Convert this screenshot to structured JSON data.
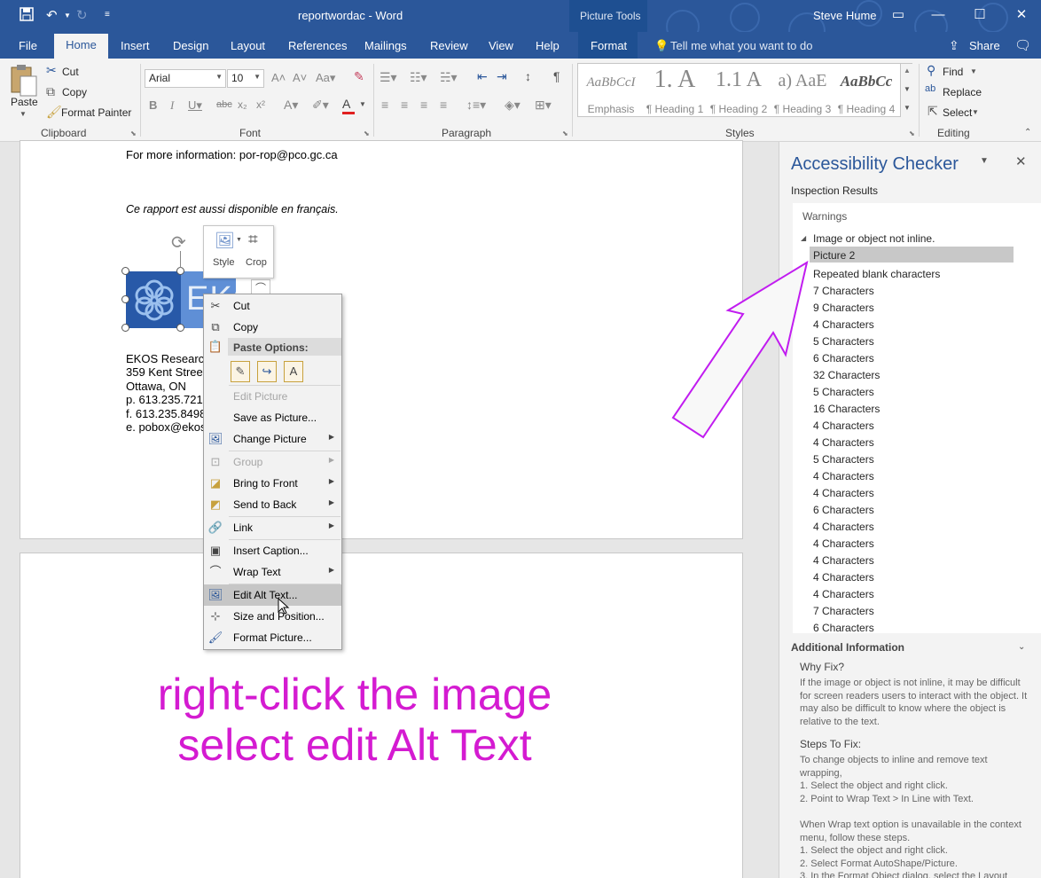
{
  "titlebar": {
    "doc_title": "reportwordac  -  Word",
    "context_title": "Picture Tools",
    "user": "Steve Hume"
  },
  "tabs": {
    "file": "File",
    "home": "Home",
    "insert": "Insert",
    "design": "Design",
    "layout": "Layout",
    "references": "References",
    "mailings": "Mailings",
    "review": "Review",
    "view": "View",
    "help": "Help",
    "format": "Format",
    "tell_me": "Tell me what you want to do",
    "share": "Share"
  },
  "ribbon": {
    "clipboard": {
      "paste": "Paste",
      "cut": "Cut",
      "copy": "Copy",
      "format_painter": "Format Painter",
      "label": "Clipboard"
    },
    "font": {
      "family": "Arial",
      "size": "10",
      "label": "Font"
    },
    "paragraph": {
      "label": "Paragraph"
    },
    "styles": {
      "label": "Styles",
      "items": [
        {
          "preview": "AaBbCcI",
          "name": "Emphasis"
        },
        {
          "preview": "1.  A",
          "name": "¶ Heading 1"
        },
        {
          "preview": "1.1  A",
          "name": "¶ Heading 2"
        },
        {
          "preview": "a)  AaE",
          "name": "¶ Heading 3"
        },
        {
          "preview": "AaBbCc",
          "name": "¶ Heading 4"
        }
      ]
    },
    "editing": {
      "find": "Find",
      "replace": "Replace",
      "select": "Select",
      "label": "Editing"
    }
  },
  "document": {
    "more_info": "For more information: por-rop@pco.gc.ca",
    "french_note": "Ce rapport est aussi disponible en français.",
    "address_lines": [
      "EKOS Research",
      "359 Kent Street",
      "Ottawa, ON",
      "p. 613.235.7215",
      "f. 613.235.8498",
      "e. pobox@ekos"
    ],
    "logo_text": "EKOS",
    "mini_toolbar": {
      "style": "Style",
      "crop": "Crop"
    }
  },
  "context_menu": {
    "cut": "Cut",
    "copy": "Copy",
    "paste_options": "Paste Options:",
    "edit_picture": "Edit Picture",
    "save_as_picture": "Save as Picture...",
    "change_picture": "Change Picture",
    "group": "Group",
    "bring_to_front": "Bring to Front",
    "send_to_back": "Send to Back",
    "link": "Link",
    "insert_caption": "Insert Caption...",
    "wrap_text": "Wrap Text",
    "edit_alt_text": "Edit Alt Text...",
    "size_and_position": "Size and Position...",
    "format_picture": "Format Picture..."
  },
  "annotation": {
    "line1": "right-click the image",
    "line2": "select edit Alt Text",
    "color": "#d41bd1"
  },
  "accessibility_pane": {
    "title": "Accessibility Checker",
    "inspection_results": "Inspection Results",
    "warnings": "Warnings",
    "group_header": "Image or object not inline.",
    "selected_item": "Picture 2",
    "items": [
      "Repeated blank characters",
      "7 Characters",
      "9 Characters",
      "4 Characters",
      "5 Characters",
      "6 Characters",
      "32 Characters",
      "5 Characters",
      "16 Characters",
      "4 Characters",
      "4 Characters",
      "5 Characters",
      "4 Characters",
      "4 Characters",
      "6 Characters",
      "4 Characters",
      "4 Characters",
      "4 Characters",
      "4 Characters",
      "4 Characters",
      "7 Characters",
      "6 Characters"
    ],
    "additional_information": "Additional Information",
    "why_fix_heading": "Why Fix?",
    "why_fix_text": "If the image or object is not inline, it may be difficult for screen readers users to interact with the object. It may also be difficult to know where the object is relative to the text.",
    "steps_heading": "Steps To Fix:",
    "steps_text_1": "To change objects to inline and remove text wrapping,",
    "steps_text_2": "1. Select the object and right click.",
    "steps_text_3": "2. Point to Wrap Text > In Line with Text.",
    "steps_text_4": "When Wrap text option is unavailable in the context menu, follow these steps.",
    "steps_text_5": "1. Select the object and right click.",
    "steps_text_6": "2. Select Format AutoShape/Picture.",
    "steps_text_7": "3. In the Format Object dialog, select the Layout"
  },
  "colors": {
    "word_blue": "#2b579a",
    "annotation_magenta": "#d41bd1",
    "arrow_outline": "#c11cf0"
  }
}
